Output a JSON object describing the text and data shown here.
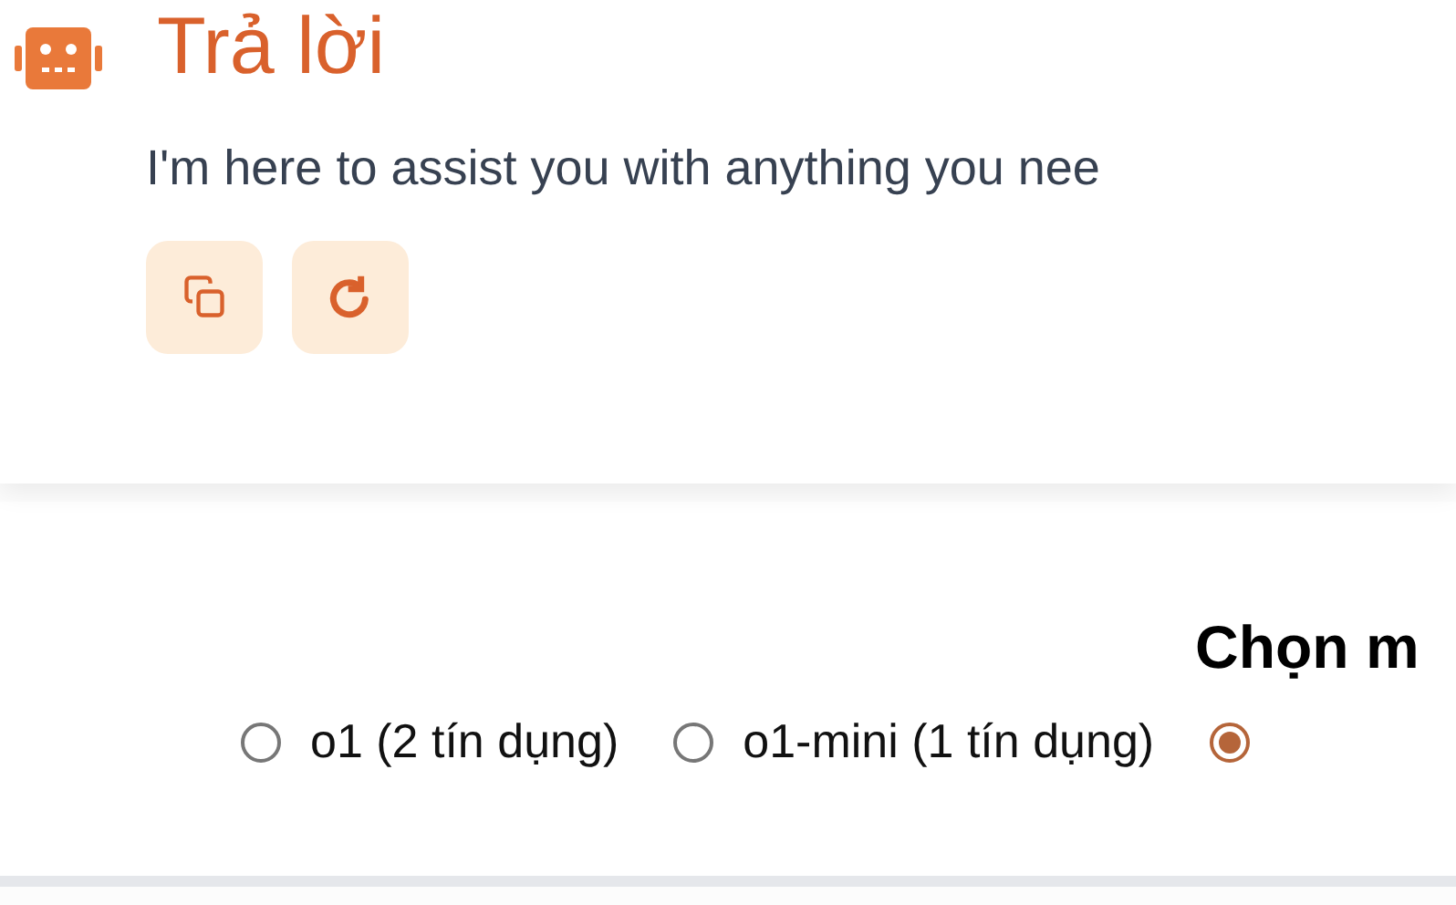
{
  "answer": {
    "title": "Trả lời",
    "text": "I'm here to assist you with anything you nee"
  },
  "actions": [
    {
      "kind": "copy"
    },
    {
      "kind": "regenerate"
    }
  ],
  "model_picker": {
    "title": "Chọn m",
    "options": [
      {
        "label": "o1 (2 tín dụng)",
        "selected": false
      },
      {
        "label": "o1-mini (1 tín dụng)",
        "selected": false
      },
      {
        "selected": true
      }
    ]
  }
}
